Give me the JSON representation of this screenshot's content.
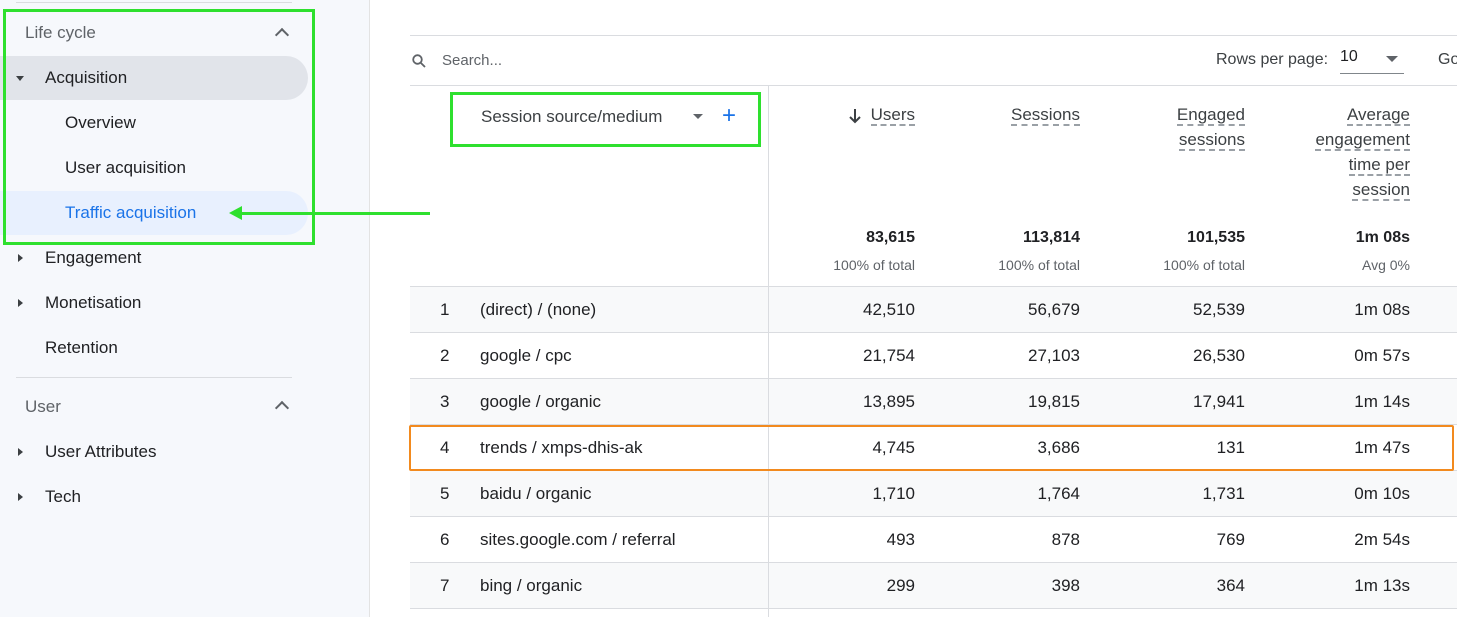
{
  "sidebar": {
    "lifecycle_title": "Life cycle",
    "acquisition": "Acquisition",
    "overview": "Overview",
    "user_acquisition": "User acquisition",
    "traffic_acquisition": "Traffic acquisition",
    "engagement": "Engagement",
    "monetisation": "Monetisation",
    "retention": "Retention",
    "user_title": "User",
    "user_attributes": "User Attributes",
    "tech": "Tech"
  },
  "toolbar": {
    "search_placeholder": "Search...",
    "rows_per_page_label": "Rows per page:",
    "rows_per_page_value": "10",
    "goto_label": "Go"
  },
  "table": {
    "dimension_header": "Session source/medium",
    "headers": {
      "users": "Users",
      "sessions": "Sessions",
      "engaged_1": "Engaged",
      "engaged_2": "sessions",
      "avg_1": "Average",
      "avg_2": "engagement",
      "avg_3": "time per",
      "avg_4": "session"
    },
    "totals": {
      "users": "83,615",
      "users_sub": "100% of total",
      "sessions": "113,814",
      "sessions_sub": "100% of total",
      "engaged": "101,535",
      "engaged_sub": "100% of total",
      "avg": "1m 08s",
      "avg_sub": "Avg 0%"
    },
    "rows": [
      {
        "idx": "1",
        "source": "(direct) / (none)",
        "users": "42,510",
        "sessions": "56,679",
        "engaged": "52,539",
        "avg": "1m 08s"
      },
      {
        "idx": "2",
        "source": "google / cpc",
        "users": "21,754",
        "sessions": "27,103",
        "engaged": "26,530",
        "avg": "0m 57s"
      },
      {
        "idx": "3",
        "source": "google / organic",
        "users": "13,895",
        "sessions": "19,815",
        "engaged": "17,941",
        "avg": "1m 14s"
      },
      {
        "idx": "4",
        "source": "trends / xmps-dhis-ak",
        "users": "4,745",
        "sessions": "3,686",
        "engaged": "131",
        "avg": "1m 47s"
      },
      {
        "idx": "5",
        "source": "baidu / organic",
        "users": "1,710",
        "sessions": "1,764",
        "engaged": "1,731",
        "avg": "0m 10s"
      },
      {
        "idx": "6",
        "source": "sites.google.com / referral",
        "users": "493",
        "sessions": "878",
        "engaged": "769",
        "avg": "2m 54s"
      },
      {
        "idx": "7",
        "source": "bing / organic",
        "users": "299",
        "sessions": "398",
        "engaged": "364",
        "avg": "1m 13s"
      }
    ]
  },
  "colors": {
    "accent_blue": "#1a73e8",
    "annotation_green": "#2ee02e",
    "annotation_orange": "#f28a1e"
  }
}
